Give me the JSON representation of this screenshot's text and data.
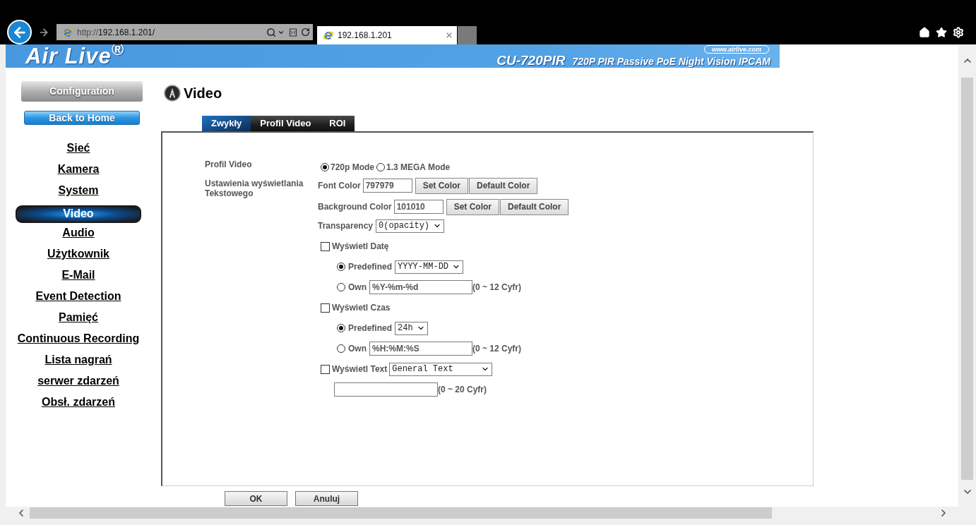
{
  "browser": {
    "url_scheme": "http://",
    "url_host": "192.168.1.201/",
    "tab_title": "192.168.1.201"
  },
  "header": {
    "logo": "Air Live$^{®}$",
    "website": "www.airlive.com",
    "model": "CU-720PIR",
    "description": "720P PIR Passive PoE Night Vision IPCAM"
  },
  "sidebar": {
    "config_button": "Configuration",
    "home_button": "Back to Home",
    "menu": [
      {
        "label": "Sieć",
        "selected": false
      },
      {
        "label": "Kamera",
        "selected": false
      },
      {
        "label": "System",
        "selected": false
      },
      {
        "label": "Video",
        "selected": true
      },
      {
        "label": "Audio",
        "selected": false
      },
      {
        "label": "Użytkownik",
        "selected": false
      },
      {
        "label": "E-Mail",
        "selected": false
      },
      {
        "label": "Event Detection",
        "selected": false
      },
      {
        "label": "Pamięć",
        "selected": false
      },
      {
        "label": "Continuous Recording",
        "selected": false
      },
      {
        "label": "Lista nagrań",
        "selected": false
      },
      {
        "label": "serwer zdarzeń",
        "selected": false
      },
      {
        "label": "Obsł. zdarzeń",
        "selected": false
      }
    ]
  },
  "page": {
    "title": "Video",
    "tabs": [
      {
        "label": "Zwykły",
        "selected": true
      },
      {
        "label": "Profil Video",
        "selected": false
      },
      {
        "label": "ROI",
        "selected": false
      }
    ]
  },
  "form": {
    "profile": {
      "label": "Profil Video",
      "options": [
        {
          "label": "720p Mode",
          "selected": true
        },
        {
          "label": "1.3 MEGA Mode",
          "selected": false
        }
      ]
    },
    "text_settings": {
      "label": "Ustawienia wyświetlania Tekstowego",
      "colors": [
        {
          "label": "Font Color",
          "value": "797979",
          "buttons": [
            "Set Color",
            "Default Color"
          ]
        },
        {
          "label": "Background Color",
          "value": "101010",
          "buttons": [
            "Set Color",
            "Default Color"
          ]
        }
      ],
      "transparency": {
        "label": "Transparency",
        "value": "0(opacity)"
      },
      "overlays": [
        {
          "kind": "format",
          "label": "Wyświetl Datę",
          "checked": false,
          "options": [
            {
              "kind": "select",
              "label": "Predefined",
              "selected": true,
              "value": "YYYY-MM-DD"
            },
            {
              "kind": "input",
              "label": "Own",
              "selected": false,
              "value": "%Y-%m-%d",
              "hint": "(0 ~ 12 Cyfr)"
            }
          ]
        },
        {
          "kind": "format",
          "label": "Wyświetl Czas",
          "checked": false,
          "options": [
            {
              "kind": "select",
              "label": "Predefined",
              "selected": true,
              "value": "24h"
            },
            {
              "kind": "input",
              "label": "Own",
              "selected": false,
              "value": "%H:%M:%S",
              "hint": "(0 ~ 12 Cyfr)"
            }
          ]
        },
        {
          "kind": "text",
          "label": "Wyświetl Text",
          "checked": false,
          "value": "General Text",
          "hint": "(0 ~ 20 Cyfr)"
        }
      ]
    }
  },
  "buttons": [
    "OK",
    "Anuluj"
  ]
}
